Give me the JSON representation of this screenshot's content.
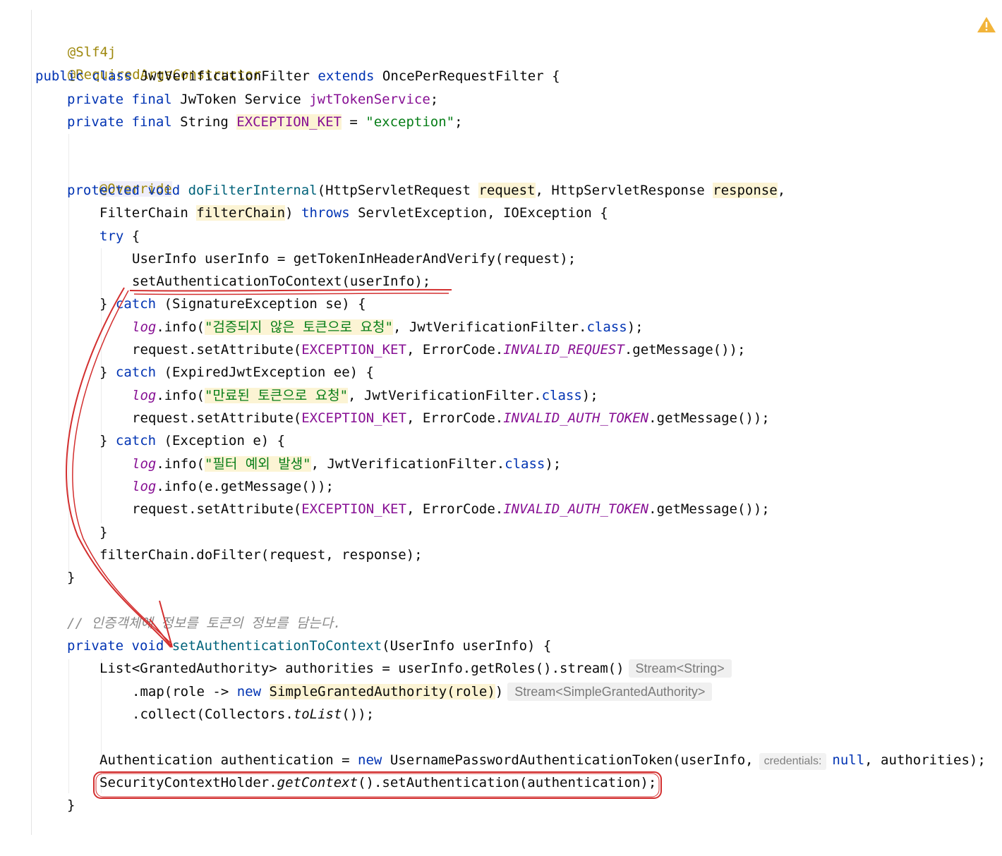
{
  "editor": {
    "warning_icon": "warning-triangle-icon",
    "colors": {
      "keyword": "#0033b3",
      "annotation": "#9e880d",
      "field": "#871094",
      "string": "#067d17",
      "comment": "#8c8c8c",
      "markup_red": "#d32f2f"
    },
    "code": {
      "l1": "@Slf4j",
      "l2": "@RequiredArgsConstructor",
      "l3": {
        "kw1": "public class",
        "name": " JwtVerificationFilter ",
        "kw2": "extends",
        "rest": " OncePerRequestFilter {"
      },
      "l4": {
        "kw": "private final",
        "type": " JwToken Service ",
        "field": "jwtTokenService",
        "end": ";"
      },
      "l5": {
        "kw": "private final",
        "type": " String ",
        "field": "EXCEPTION_KET",
        "eq": " = ",
        "str": "\"exception\"",
        "end": ";"
      },
      "l6": "@Override",
      "l7": {
        "kw": "protected void",
        "sp": " ",
        "method": "doFilterInternal",
        "p1": "(HttpServletRequest ",
        "req": "request",
        "p2": ", HttpServletResponse ",
        "resp": "response",
        "end": ","
      },
      "l8": {
        "t": "FilterChain ",
        "fc": "filterChain",
        "p": ") ",
        "kw": "throws",
        "rest": " ServletException, IOException {"
      },
      "l9": {
        "kw": "try",
        "rest": " {"
      },
      "l10": "UserInfo userInfo = getTokenInHeaderAndVerify(request);",
      "l11": "setAuthenticationToContext(userInfo);",
      "l12": {
        "pre": "} ",
        "kw": "catch",
        "rest": " (SignatureException se) {"
      },
      "l13": {
        "log": "log",
        "a": ".info(",
        "str": "\"검증되지 않은 토큰으로 요청\"",
        "b": ", JwtVerificationFilter.",
        "kw": "class",
        "c": ");"
      },
      "l14": {
        "a": "request.setAttribute(",
        "f": "EXCEPTION_KET",
        "b": ", ErrorCode.",
        "e": "INVALID_REQUEST",
        "c": ".getMessage());"
      },
      "l15": {
        "pre": "} ",
        "kw": "catch",
        "rest": " (ExpiredJwtException ee) {"
      },
      "l16": {
        "log": "log",
        "a": ".info(",
        "str": "\"만료된 토큰으로 요청\"",
        "b": ", JwtVerificationFilter.",
        "kw": "class",
        "c": ");"
      },
      "l17": {
        "a": "request.setAttribute(",
        "f": "EXCEPTION_KET",
        "b": ", ErrorCode.",
        "e": "INVALID_AUTH_TOKEN",
        "c": ".getMessage());"
      },
      "l18": {
        "pre": "} ",
        "kw": "catch",
        "rest": " (Exception e) {"
      },
      "l19": {
        "log": "log",
        "a": ".info(",
        "str": "\"필터 예외 발생\"",
        "b": ", JwtVerificationFilter.",
        "kw": "class",
        "c": ");"
      },
      "l20": {
        "log": "log",
        "a": ".info(e.getMessage());"
      },
      "l21": {
        "a": "request.setAttribute(",
        "f": "EXCEPTION_KET",
        "b": ", ErrorCode.",
        "e": "INVALID_AUTH_TOKEN",
        "c": ".getMessage());"
      },
      "l22": "}",
      "l23": "filterChain.doFilter(request, response);",
      "l24": "}",
      "l25": "// 인증객체에 정보를 토큰의 정보를 담는다.",
      "l26": {
        "kw": "private void",
        "sp": " ",
        "method": "setAuthenticationToContext",
        "rest": "(UserInfo userInfo) {"
      },
      "l27": {
        "code": "List<GrantedAuthority> authorities = userInfo.getRoles().stream()",
        "hint": "Stream<String>"
      },
      "l28": {
        "a": ".map(role -> ",
        "kw": "new",
        "sp": " ",
        "hl": "SimpleGrantedAuthority(role)",
        "b": ")",
        "hint": "Stream<SimpleGrantedAuthority>"
      },
      "l29": {
        "a": ".collect(Collectors.",
        "m": "toList",
        "b": "());"
      },
      "l30": {
        "a": "Authentication authentication = ",
        "kw": "new",
        "b": " UsernamePasswordAuthenticationToken(userInfo,",
        "hint": "credentials:",
        "kw2": "null",
        "c": ", authorities);"
      },
      "l31": {
        "a": "SecurityContextHolder.",
        "m": "getContext",
        "b": "().setAuthentication(authentication);"
      },
      "l32": "}"
    }
  }
}
